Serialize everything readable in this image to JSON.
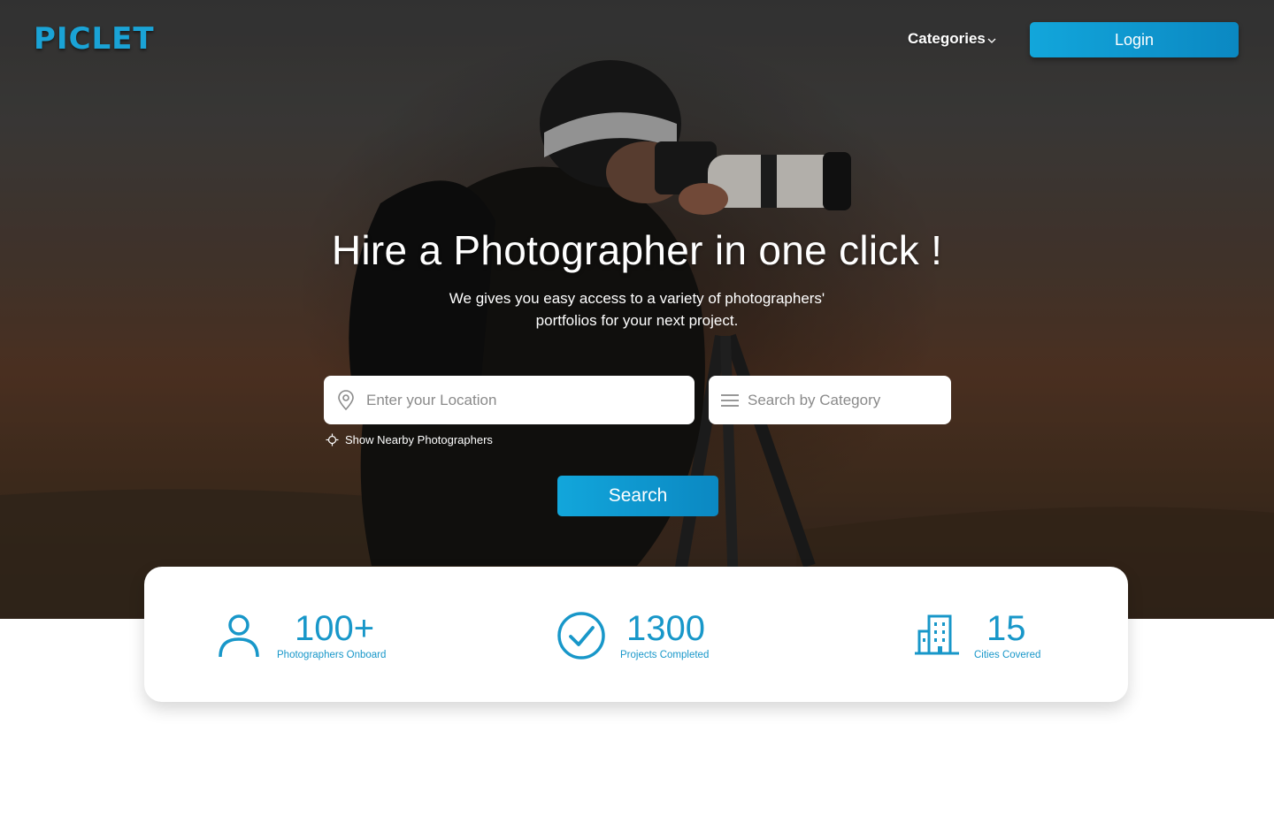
{
  "brand": {
    "logo_text": "PICLET",
    "accent": "#1aa3d6"
  },
  "nav": {
    "categories_label": "Categories",
    "login_label": "Login"
  },
  "hero": {
    "title": "Hire a Photographer in one click !",
    "subtitle_line1": "We gives you easy access to a variety of photographers'",
    "subtitle_line2": "portfolios for your next project."
  },
  "search": {
    "location_placeholder": "Enter your Location",
    "location_icon": "map-pin-icon",
    "category_placeholder": "Search by Category",
    "category_icon": "menu-lines-icon",
    "nearby_label": "Show Nearby Photographers",
    "nearby_icon": "crosshair-icon",
    "button_label": "Search"
  },
  "stats": [
    {
      "icon": "user-icon",
      "value": "100+",
      "label": "Photographers Onboard"
    },
    {
      "icon": "check-circle-icon",
      "value": "1300",
      "label": "Projects Completed"
    },
    {
      "icon": "building-icon",
      "value": "15",
      "label": "Cities Covered"
    }
  ]
}
